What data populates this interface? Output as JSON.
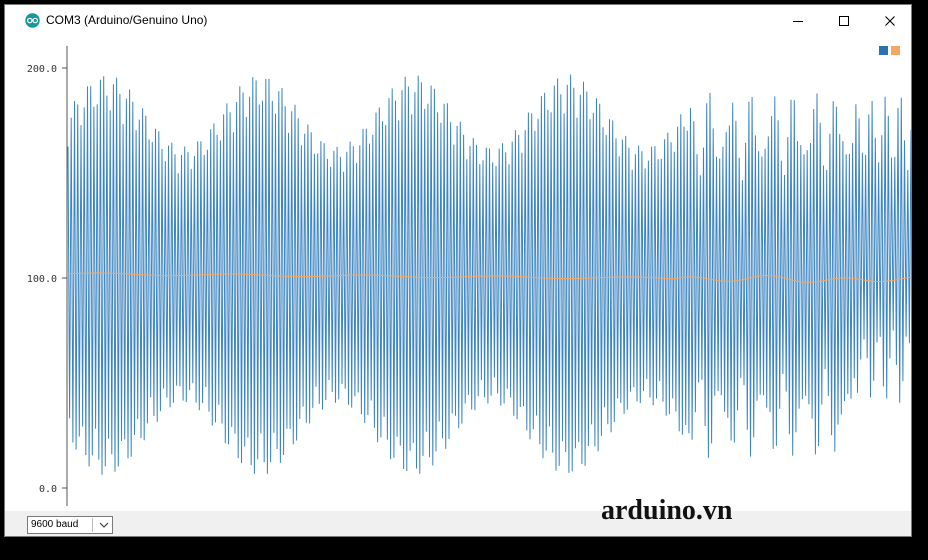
{
  "window": {
    "title": "COM3 (Arduino/Genuino Uno)",
    "icon": "arduino-logo-icon",
    "controls": [
      "minimize-icon",
      "maximize-icon",
      "close-icon"
    ]
  },
  "plotter": {
    "legend": [
      {
        "color": "#2a73b0"
      },
      {
        "color": "#f5a864"
      }
    ]
  },
  "chart_data": {
    "type": "line",
    "ylim": [
      0,
      200
    ],
    "yticks": [
      "200.0",
      "100.0",
      "0.0"
    ],
    "grid": false,
    "legend_position": "top-right",
    "series": [
      {
        "color": "#3d85c0",
        "shape": "dense oscillation",
        "low": 0,
        "high": 197,
        "segments": [
          {
            "start": 0.0,
            "end": 0.73,
            "low": 6,
            "high": 197
          },
          {
            "start": 0.73,
            "end": 0.83,
            "low": 13,
            "high": 190
          },
          {
            "start": 0.83,
            "end": 0.93,
            "low": 12,
            "high": 191
          },
          {
            "start": 0.93,
            "end": 1.0,
            "low": 40,
            "high": 188
          }
        ]
      },
      {
        "color": "#f5a864",
        "shape": "slowly drifting mean",
        "values_start": 102,
        "values_end": 99
      }
    ]
  },
  "bottom": {
    "baud": "9600 baud",
    "watermark": "arduino.vn"
  }
}
